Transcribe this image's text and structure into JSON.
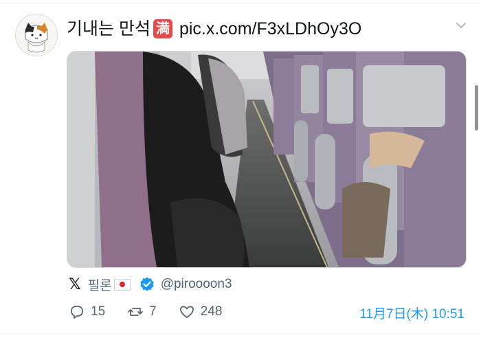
{
  "tweet": {
    "text_korean": "기내는 만석",
    "badge_char": "満",
    "link_text": "pic.x.com/F3xLDhOy3O"
  },
  "quoted": {
    "display_name": "필론",
    "handle": "@piroooon3"
  },
  "stats": {
    "replies": "15",
    "retweets": "7",
    "likes": "248"
  },
  "timestamp": "11月7日(木) 10:51",
  "colors": {
    "accent": "#1d9bf0",
    "badge": "#e84a4a",
    "muted": "#536471"
  }
}
